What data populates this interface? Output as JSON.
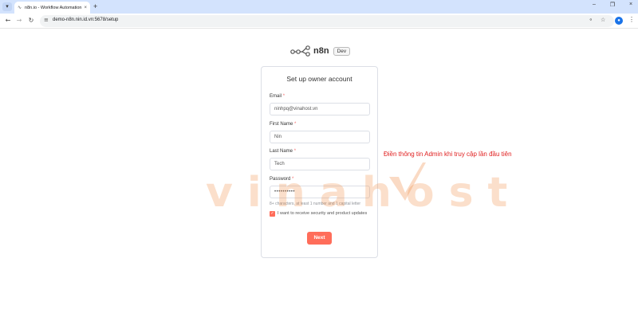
{
  "browser": {
    "tab_title": "n8n.io - Workflow Automation",
    "url": "demo-n8n.nin.id.vn:5678/setup"
  },
  "app": {
    "name": "n8n",
    "badge": "Dev"
  },
  "form": {
    "title": "Set up owner account",
    "email": {
      "label": "Email",
      "value": "ninhpq@vinahost.vn"
    },
    "first_name": {
      "label": "First Name",
      "value": "Nin"
    },
    "last_name": {
      "label": "Last Name",
      "value": "Tech"
    },
    "password": {
      "label": "Password",
      "value": "••••••••••"
    },
    "required_marker": "*",
    "password_hint": "8+ characters, at least 1 number and 1 capital letter",
    "checkbox_label": "I want to receive security and product updates",
    "checkbox_checked": true,
    "next_label": "Next"
  },
  "annotation": "Điền thông tin Admin khi truy cập lần đầu tiên",
  "watermark": "vinahost",
  "colors": {
    "accent": "#ff6d5a",
    "annotation": "#e02020"
  }
}
